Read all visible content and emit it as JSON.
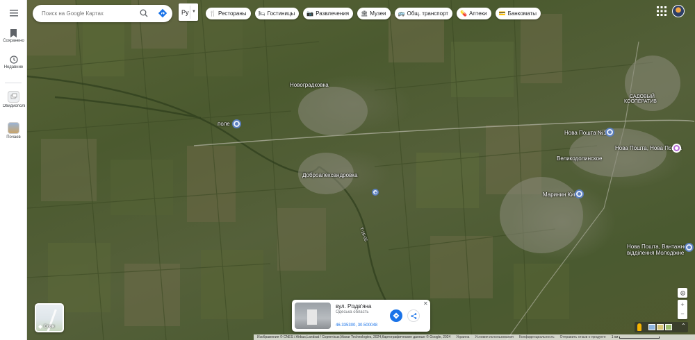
{
  "rail": {
    "items": [
      {
        "label": "Сохранено"
      },
      {
        "label": "Недавние"
      },
      {
        "label": "Овидиопольский..."
      },
      {
        "label": "Почаев"
      }
    ]
  },
  "search": {
    "placeholder": "Поиск на Google Картах"
  },
  "lang": {
    "value": "Ру"
  },
  "chips": [
    {
      "label": "Рестораны",
      "icon": "🍴"
    },
    {
      "label": "Гостиницы",
      "icon": "🛏"
    },
    {
      "label": "Развлечения",
      "icon": "📷"
    },
    {
      "label": "Музеи",
      "icon": "🏛"
    },
    {
      "label": "Общ. транспорт",
      "icon": "🚌"
    },
    {
      "label": "Аптеки",
      "icon": "💊"
    },
    {
      "label": "Банкоматы",
      "icon": "💳"
    }
  ],
  "map": {
    "places": {
      "novogradkovka": "Новоградковка",
      "pole": "поле",
      "dobroaleksandrovka": "Доброалександровка",
      "sadovy_1": "САДОВЫЙ",
      "sadovy_2": "КООПЕРАТИВ",
      "nova_poshta_1": "Нова Пошта №1",
      "nova_poshta_2": "Нова Пошта, Нова Пошта",
      "velikodolinskoe": "Великодолинское",
      "marinin": "Маринин Кинг",
      "nova_poshta_3a": "Нова Пошта, Вантажне",
      "nova_poshta_3b": "відділення Молодіжне",
      "road": "Т-16-05"
    }
  },
  "layers": {
    "label": "Слои"
  },
  "card": {
    "title": "вул. Різдв'яна",
    "subtitle": "Одеська область",
    "coords": "46.335300, 30.500048"
  },
  "footer": {
    "attribution": "Изображения © CNES / Airbus,Landsat / Copernicus,Maxar Technologies, 2024,Картографические данные © Google, 2024",
    "country": "Украина",
    "terms": "Условия использования",
    "privacy": "Конфиденциальность",
    "feedback": "Отправить отзыв о продукте",
    "scale": "1 км"
  },
  "colors": {
    "accent": "#1a73e8",
    "map_green": "#4b5a2f"
  }
}
